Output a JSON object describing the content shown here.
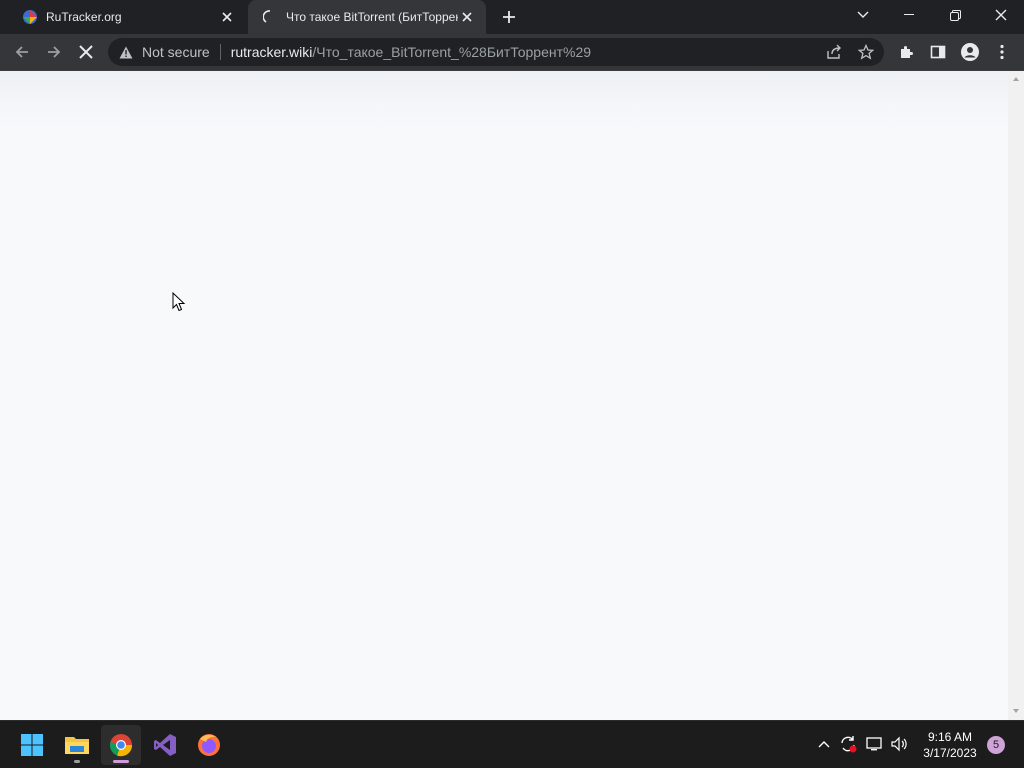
{
  "tabs": [
    {
      "title": "RuTracker.org",
      "icon": "rutracker-favicon",
      "active": false
    },
    {
      "title": "Что такое BitTorrent (БитТоррент)",
      "icon": "loading-spinner-icon",
      "active": true
    }
  ],
  "omnibox": {
    "security": "Not secure",
    "host": "rutracker.wiki",
    "path": "/Что_такое_BitTorrent_%28БитТоррент%29"
  },
  "taskbar": {
    "apps": [
      "windows-start",
      "file-explorer",
      "google-chrome",
      "visual-studio",
      "firefox"
    ],
    "time": "9:16 AM",
    "date": "3/17/2023",
    "notifications": "5"
  },
  "colors": {
    "tabstrip": "#202124",
    "toolbar": "#35363a",
    "page": "#f8f9fb",
    "taskbar": "#1c1c1c"
  }
}
